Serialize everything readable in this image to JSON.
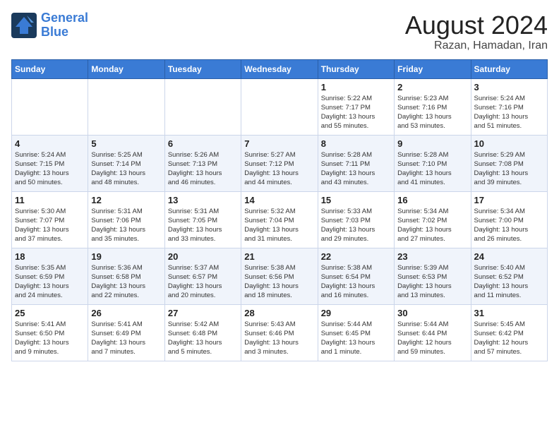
{
  "header": {
    "logo_line1": "General",
    "logo_line2": "Blue",
    "month_year": "August 2024",
    "location": "Razan, Hamadan, Iran"
  },
  "days_of_week": [
    "Sunday",
    "Monday",
    "Tuesday",
    "Wednesday",
    "Thursday",
    "Friday",
    "Saturday"
  ],
  "weeks": [
    [
      {
        "day": "",
        "info": ""
      },
      {
        "day": "",
        "info": ""
      },
      {
        "day": "",
        "info": ""
      },
      {
        "day": "",
        "info": ""
      },
      {
        "day": "1",
        "info": "Sunrise: 5:22 AM\nSunset: 7:17 PM\nDaylight: 13 hours\nand 55 minutes."
      },
      {
        "day": "2",
        "info": "Sunrise: 5:23 AM\nSunset: 7:16 PM\nDaylight: 13 hours\nand 53 minutes."
      },
      {
        "day": "3",
        "info": "Sunrise: 5:24 AM\nSunset: 7:16 PM\nDaylight: 13 hours\nand 51 minutes."
      }
    ],
    [
      {
        "day": "4",
        "info": "Sunrise: 5:24 AM\nSunset: 7:15 PM\nDaylight: 13 hours\nand 50 minutes."
      },
      {
        "day": "5",
        "info": "Sunrise: 5:25 AM\nSunset: 7:14 PM\nDaylight: 13 hours\nand 48 minutes."
      },
      {
        "day": "6",
        "info": "Sunrise: 5:26 AM\nSunset: 7:13 PM\nDaylight: 13 hours\nand 46 minutes."
      },
      {
        "day": "7",
        "info": "Sunrise: 5:27 AM\nSunset: 7:12 PM\nDaylight: 13 hours\nand 44 minutes."
      },
      {
        "day": "8",
        "info": "Sunrise: 5:28 AM\nSunset: 7:11 PM\nDaylight: 13 hours\nand 43 minutes."
      },
      {
        "day": "9",
        "info": "Sunrise: 5:28 AM\nSunset: 7:10 PM\nDaylight: 13 hours\nand 41 minutes."
      },
      {
        "day": "10",
        "info": "Sunrise: 5:29 AM\nSunset: 7:08 PM\nDaylight: 13 hours\nand 39 minutes."
      }
    ],
    [
      {
        "day": "11",
        "info": "Sunrise: 5:30 AM\nSunset: 7:07 PM\nDaylight: 13 hours\nand 37 minutes."
      },
      {
        "day": "12",
        "info": "Sunrise: 5:31 AM\nSunset: 7:06 PM\nDaylight: 13 hours\nand 35 minutes."
      },
      {
        "day": "13",
        "info": "Sunrise: 5:31 AM\nSunset: 7:05 PM\nDaylight: 13 hours\nand 33 minutes."
      },
      {
        "day": "14",
        "info": "Sunrise: 5:32 AM\nSunset: 7:04 PM\nDaylight: 13 hours\nand 31 minutes."
      },
      {
        "day": "15",
        "info": "Sunrise: 5:33 AM\nSunset: 7:03 PM\nDaylight: 13 hours\nand 29 minutes."
      },
      {
        "day": "16",
        "info": "Sunrise: 5:34 AM\nSunset: 7:02 PM\nDaylight: 13 hours\nand 27 minutes."
      },
      {
        "day": "17",
        "info": "Sunrise: 5:34 AM\nSunset: 7:00 PM\nDaylight: 13 hours\nand 26 minutes."
      }
    ],
    [
      {
        "day": "18",
        "info": "Sunrise: 5:35 AM\nSunset: 6:59 PM\nDaylight: 13 hours\nand 24 minutes."
      },
      {
        "day": "19",
        "info": "Sunrise: 5:36 AM\nSunset: 6:58 PM\nDaylight: 13 hours\nand 22 minutes."
      },
      {
        "day": "20",
        "info": "Sunrise: 5:37 AM\nSunset: 6:57 PM\nDaylight: 13 hours\nand 20 minutes."
      },
      {
        "day": "21",
        "info": "Sunrise: 5:38 AM\nSunset: 6:56 PM\nDaylight: 13 hours\nand 18 minutes."
      },
      {
        "day": "22",
        "info": "Sunrise: 5:38 AM\nSunset: 6:54 PM\nDaylight: 13 hours\nand 16 minutes."
      },
      {
        "day": "23",
        "info": "Sunrise: 5:39 AM\nSunset: 6:53 PM\nDaylight: 13 hours\nand 13 minutes."
      },
      {
        "day": "24",
        "info": "Sunrise: 5:40 AM\nSunset: 6:52 PM\nDaylight: 13 hours\nand 11 minutes."
      }
    ],
    [
      {
        "day": "25",
        "info": "Sunrise: 5:41 AM\nSunset: 6:50 PM\nDaylight: 13 hours\nand 9 minutes."
      },
      {
        "day": "26",
        "info": "Sunrise: 5:41 AM\nSunset: 6:49 PM\nDaylight: 13 hours\nand 7 minutes."
      },
      {
        "day": "27",
        "info": "Sunrise: 5:42 AM\nSunset: 6:48 PM\nDaylight: 13 hours\nand 5 minutes."
      },
      {
        "day": "28",
        "info": "Sunrise: 5:43 AM\nSunset: 6:46 PM\nDaylight: 13 hours\nand 3 minutes."
      },
      {
        "day": "29",
        "info": "Sunrise: 5:44 AM\nSunset: 6:45 PM\nDaylight: 13 hours\nand 1 minute."
      },
      {
        "day": "30",
        "info": "Sunrise: 5:44 AM\nSunset: 6:44 PM\nDaylight: 12 hours\nand 59 minutes."
      },
      {
        "day": "31",
        "info": "Sunrise: 5:45 AM\nSunset: 6:42 PM\nDaylight: 12 hours\nand 57 minutes."
      }
    ]
  ]
}
